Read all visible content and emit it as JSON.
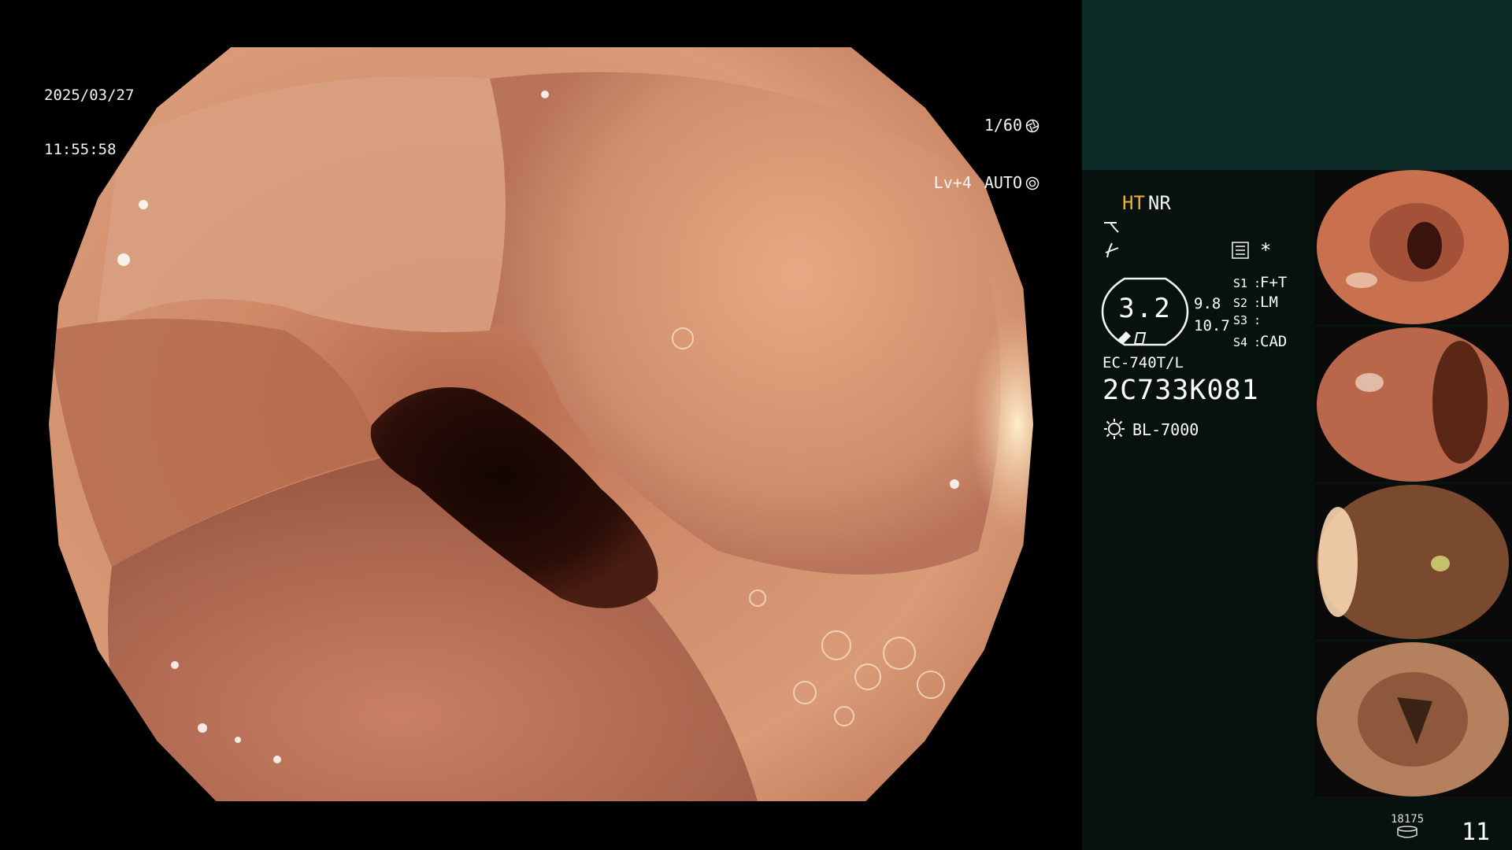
{
  "overlay": {
    "date": "2025/03/27",
    "time": "11:55:58",
    "shutter": "1/60",
    "level": "Lv+4",
    "mode": "AUTO"
  },
  "panel": {
    "ht": "HT",
    "nr": "NR",
    "oval_value": "3.2",
    "oval_sub_1": "9.8",
    "oval_sub_2": "10.7",
    "s_settings": [
      {
        "key": "S1",
        "value": "F+T"
      },
      {
        "key": "S2",
        "value": "LM"
      },
      {
        "key": "S3",
        "value": ""
      },
      {
        "key": "S4",
        "value": "CAD"
      }
    ],
    "scope_model": "EC-740T/L",
    "scope_serial": "2C733K081",
    "light_source": "BL-7000",
    "image_count_small": "18175",
    "image_count_big": "11"
  },
  "icons": {
    "shutter_icon": "aperture-icon",
    "auto_icon": "iris-icon",
    "tone_icon": "tone-curve-icon",
    "edge_icon": "edge-enhance-icon",
    "menu_icon": "settings-list-icon",
    "scope_icon": "scope-status-icon",
    "light_icon": "lightbulb-icon",
    "storage_icon": "storage-icon"
  },
  "colors": {
    "ht_accent": "#f0b030",
    "panel_top": "#0e2a26",
    "panel_main": "#07120f"
  }
}
